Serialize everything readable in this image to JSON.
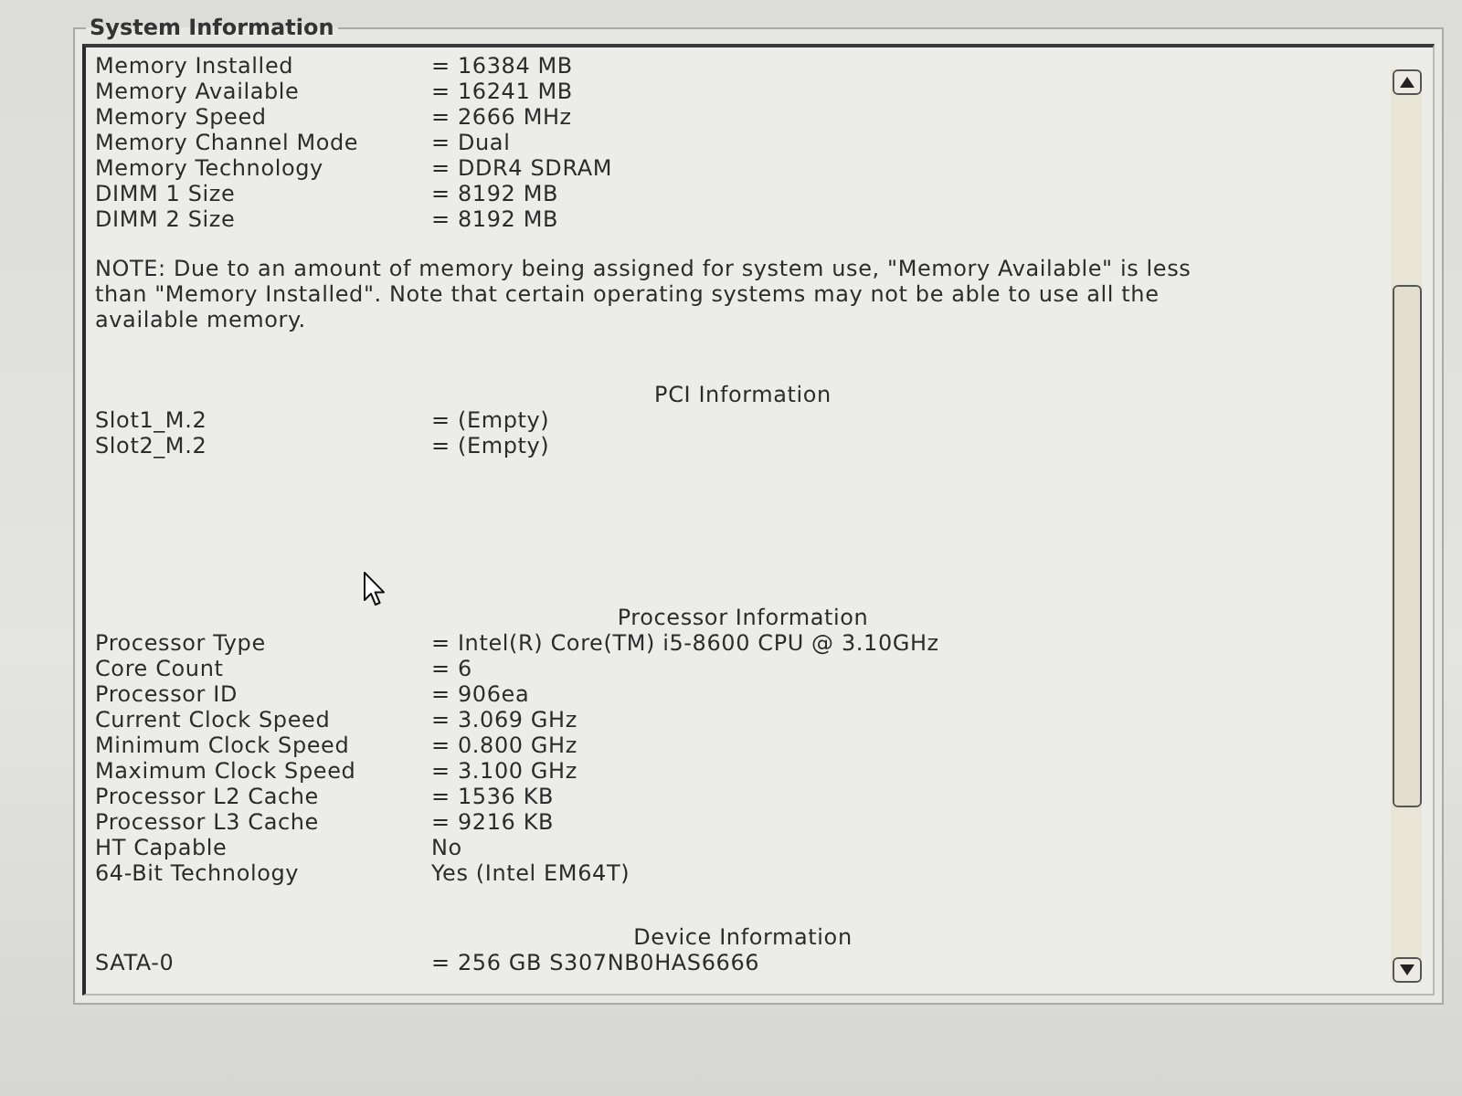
{
  "group": {
    "title": "System Information"
  },
  "sections": [
    {
      "kind": "fields",
      "rows": [
        {
          "label": "Memory Installed",
          "value": "= 16384 MB"
        },
        {
          "label": "Memory Available",
          "value": "= 16241 MB"
        },
        {
          "label": "Memory Speed",
          "value": "= 2666 MHz"
        },
        {
          "label": "Memory Channel Mode",
          "value": "= Dual"
        },
        {
          "label": "Memory Technology",
          "value": "= DDR4 SDRAM"
        },
        {
          "label": "DIMM 1 Size",
          "value": "= 8192 MB"
        },
        {
          "label": "DIMM 2 Size",
          "value": "= 8192 MB"
        }
      ]
    },
    {
      "kind": "note",
      "text": "NOTE: Due to an amount of memory being assigned for system use, \"Memory Available\" is less than \"Memory Installed\". Note that certain operating systems may not be able to use all the available memory."
    },
    {
      "kind": "fields",
      "heading": "PCI Information",
      "rows": [
        {
          "label": "Slot1_M.2",
          "value": "= (Empty)"
        },
        {
          "label": "Slot2_M.2",
          "value": "= (Empty)"
        }
      ]
    },
    {
      "kind": "fields",
      "heading": "Processor Information",
      "rows": [
        {
          "label": "Processor Type",
          "value": "= Intel(R) Core(TM) i5-8600 CPU @ 3.10GHz"
        },
        {
          "label": "Core Count",
          "value": "= 6"
        },
        {
          "label": "Processor ID",
          "value": "= 906ea"
        },
        {
          "label": "Current Clock Speed",
          "value": "= 3.069 GHz"
        },
        {
          "label": "Minimum Clock Speed",
          "value": "= 0.800 GHz"
        },
        {
          "label": "Maximum Clock Speed",
          "value": "= 3.100 GHz"
        },
        {
          "label": "Processor L2 Cache",
          "value": "= 1536 KB"
        },
        {
          "label": "Processor L3 Cache",
          "value": "= 9216 KB"
        },
        {
          "label": "HT Capable",
          "value": "No"
        },
        {
          "label": "64-Bit Technology",
          "value": "Yes (Intel EM64T)"
        }
      ]
    },
    {
      "kind": "fields",
      "heading": "Device Information",
      "rows": [
        {
          "label": "SATA-0",
          "value": "= 256 GB S307NB0HAS6666"
        }
      ]
    }
  ]
}
